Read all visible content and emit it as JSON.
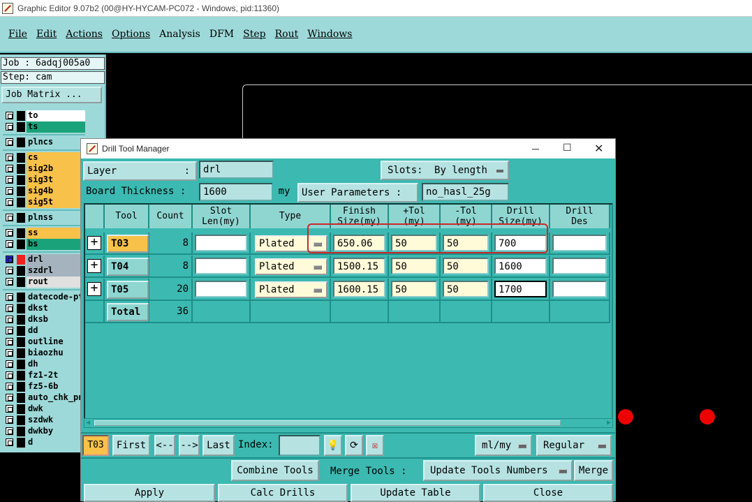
{
  "window": {
    "title": "Graphic Editor 9.07b2 (00@HY-HYCAM-PC072 - Windows, pid:11360)"
  },
  "menu": [
    "File",
    "Edit",
    "Actions",
    "Options",
    "Analysis",
    "DFM",
    "Step",
    "Rout",
    "Windows"
  ],
  "left": {
    "job": "Job : 6adqj005a0",
    "step": "Step: cam",
    "job_matrix": "Job Matrix ...",
    "layers": [
      {
        "name": "to",
        "color": "#ffffff"
      },
      {
        "name": "ts",
        "color": "#1aa37a"
      },
      {
        "name": "plncs",
        "color": "#9ed9d9"
      },
      {
        "name": "cs",
        "color": "#f7c14a"
      },
      {
        "name": "sig2b",
        "color": "#f7c14a"
      },
      {
        "name": "sig3t",
        "color": "#f7c14a"
      },
      {
        "name": "sig4b",
        "color": "#f7c14a"
      },
      {
        "name": "sig5t",
        "color": "#f7c14a"
      },
      {
        "name": "plnss",
        "color": "#9ed9d9"
      },
      {
        "name": "ss",
        "color": "#f7c14a"
      },
      {
        "name": "bs",
        "color": "#1aa37a"
      },
      {
        "name": "drl",
        "color": "#a4b3bd"
      },
      {
        "name": "szdrl",
        "color": "#a4b3bd"
      },
      {
        "name": "rout",
        "color": "#e0e0e0"
      },
      {
        "name": "datecode-pt",
        "color": "#9ed9d9"
      },
      {
        "name": "dkst",
        "color": "#9ed9d9"
      },
      {
        "name": "dksb",
        "color": "#9ed9d9"
      },
      {
        "name": "dd",
        "color": "#9ed9d9"
      },
      {
        "name": "outline",
        "color": "#9ed9d9"
      },
      {
        "name": "biaozhu",
        "color": "#9ed9d9"
      },
      {
        "name": "dh",
        "color": "#9ed9d9"
      },
      {
        "name": "fz1-2t",
        "color": "#9ed9d9"
      },
      {
        "name": "fz5-6b",
        "color": "#9ed9d9"
      },
      {
        "name": "auto_chk_pn",
        "color": "#9ed9d9"
      },
      {
        "name": "dwk",
        "color": "#9ed9d9"
      },
      {
        "name": "szdwk",
        "color": "#9ed9d9"
      },
      {
        "name": "dwkby",
        "color": "#9ed9d9"
      },
      {
        "name": "d",
        "color": "#9ed9d9"
      }
    ]
  },
  "dialog": {
    "title": "Drill Tool Manager",
    "layer_label": "Layer",
    "layer_colon": ":",
    "layer_value": "drl",
    "slots_label": "Slots:",
    "slots_value": "By length",
    "thickness_label": "Board Thickness :",
    "thickness_value": "1600",
    "thickness_unit": "my",
    "user_params_label": "User Parameters :",
    "user_params_value": "no_hasl_25g",
    "headers": {
      "tool": "Tool",
      "count": "Count",
      "slot_len_1": "Slot",
      "slot_len_2": "Len(my)",
      "type": "Type",
      "finish_1": "Finish",
      "finish_2": "Size(my)",
      "ptol_1": "+Tol",
      "ptol_2": "(my)",
      "ntol_1": "-Tol",
      "ntol_2": "(my)",
      "drill_1": "Drill",
      "drill_2": "Size(my)",
      "drilldes_1": "Drill",
      "drilldes_2": "Des"
    },
    "rows": [
      {
        "tool": "T03",
        "count": "8",
        "type": "Plated",
        "finish": "650.06",
        "ptol": "50",
        "ntol": "50",
        "drill": "700"
      },
      {
        "tool": "T04",
        "count": "8",
        "type": "Plated",
        "finish": "1500.15",
        "ptol": "50",
        "ntol": "50",
        "drill": "1600"
      },
      {
        "tool": "T05",
        "count": "20",
        "type": "Plated",
        "finish": "1600.15",
        "ptol": "50",
        "ntol": "50",
        "drill": "1700"
      }
    ],
    "total_label": "Total",
    "total_count": "36",
    "current_tool": "T03",
    "nav": {
      "first": "First",
      "prev": "<--",
      "next": "-->",
      "last": "Last",
      "index_label": "Index:"
    },
    "units": "ml/my",
    "mode": "Regular",
    "combine": "Combine Tools",
    "merge_tools_label": "Merge Tools :",
    "merge_option": "Update Tools Numbers",
    "merge": "Merge",
    "buttons": {
      "apply": "Apply",
      "calc": "Calc Drills",
      "update": "Update Table",
      "close": "Close"
    }
  }
}
